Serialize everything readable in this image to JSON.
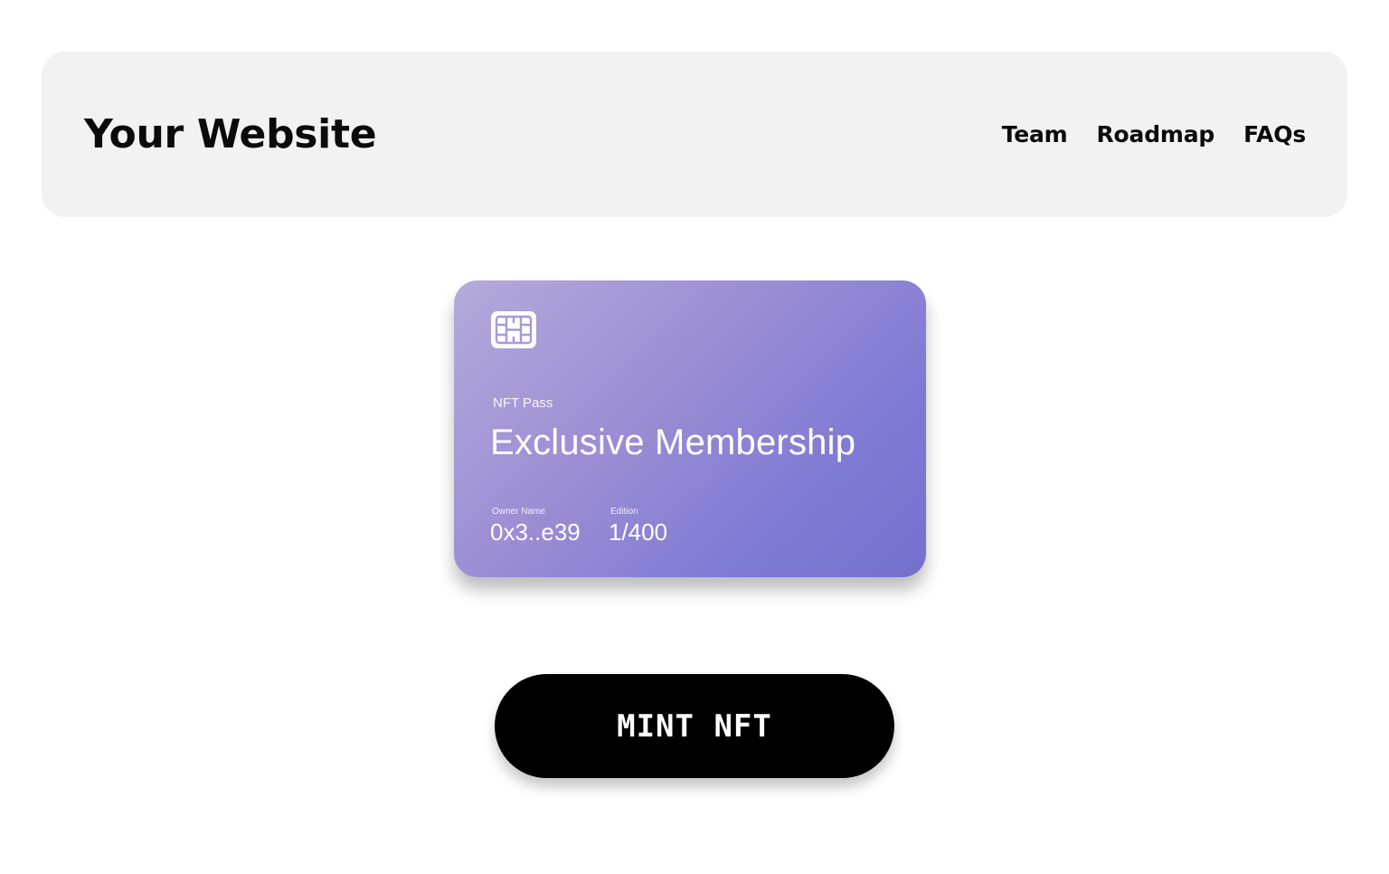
{
  "header": {
    "brand": "Your Website",
    "nav": [
      {
        "label": "Team"
      },
      {
        "label": "Roadmap"
      },
      {
        "label": "FAQs"
      }
    ]
  },
  "card": {
    "icon": "sim-chip-icon",
    "kicker": "NFT Pass",
    "title": "Exclusive Membership",
    "owner_label": "Owner Name",
    "owner_value": "0x3..e39",
    "edition_label": "Edition",
    "edition_value": "1/400",
    "gradient_colors": [
      "#b4aadb",
      "#988bd3",
      "#7e7ad4",
      "#7570cc"
    ]
  },
  "actions": {
    "mint_label": "MINT NFT"
  },
  "colors": {
    "header_bg": "#f2f2f2",
    "button_bg": "#000000",
    "text_dark": "#0b0b0b"
  }
}
